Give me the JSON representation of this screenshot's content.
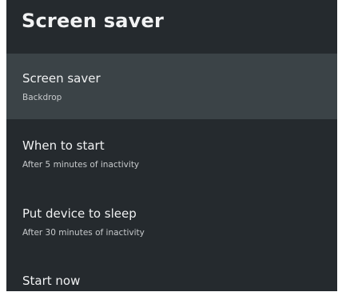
{
  "header": {
    "title": "Screen saver"
  },
  "settings": {
    "items": [
      {
        "title": "Screen saver",
        "subtitle": "Backdrop"
      },
      {
        "title": "When to start",
        "subtitle": "After 5 minutes of inactivity"
      },
      {
        "title": "Put device to sleep",
        "subtitle": "After 30 minutes of inactivity"
      },
      {
        "title": "Start now"
      }
    ]
  },
  "colors": {
    "panel_background": "#252a2e",
    "focused_item_background": "#3b4347",
    "primary_text": "#f0f1f2",
    "secondary_text": "#c7cacc"
  }
}
